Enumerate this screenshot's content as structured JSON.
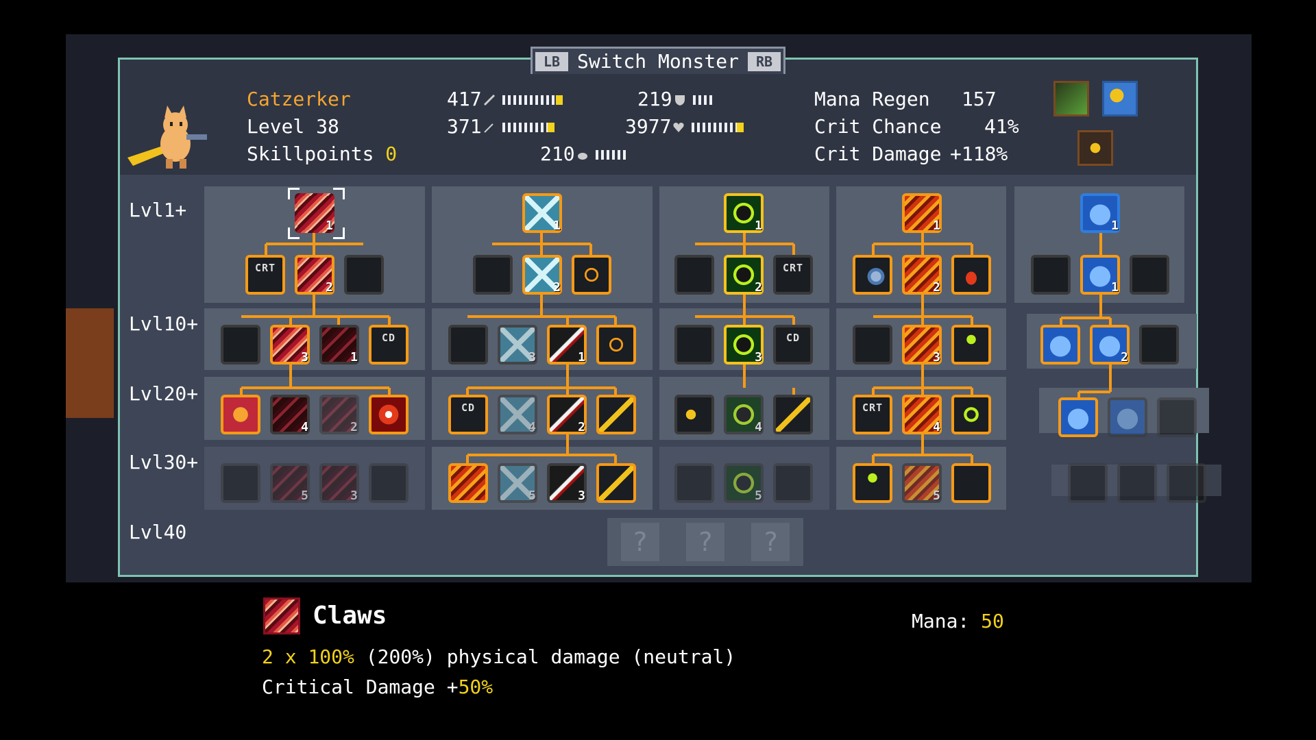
{
  "header": {
    "switch_label": "Switch Monster",
    "lb": "LB",
    "rb": "RB"
  },
  "monster": {
    "name": "Catzerker",
    "level_label": "Level 38",
    "skillpoints_label": "Skillpoints",
    "skillpoints_value": "0"
  },
  "stats": {
    "attack": "417",
    "magic": "371",
    "defense": "219",
    "health": "3977",
    "mana": "210",
    "mana_regen_label": "Mana Regen",
    "mana_regen_value": "157",
    "crit_chance_label": "Crit Chance",
    "crit_chance_value": "41%",
    "crit_damage_label": "Crit Damage",
    "crit_damage_value": "+118%"
  },
  "rows": {
    "lvl1": "Lvl1+",
    "lvl10": "Lvl10+",
    "lvl20": "Lvl20+",
    "lvl30": "Lvl30+",
    "lvl40": "Lvl40"
  },
  "skill_text": {
    "crt": "CRT",
    "cd": "CD",
    "q": "?"
  },
  "ranks": [
    "1",
    "2",
    "3",
    "4",
    "5"
  ],
  "tooltip": {
    "title": "Claws",
    "mana_label": "Mana:",
    "mana_value": "50",
    "line1_a": "2 x ",
    "line1_b": "100%",
    "line1_c": " (200%) physical damage (neutral)",
    "line2_a": "Critical Damage +",
    "line2_b": "50%"
  },
  "colors": {
    "accent_orange": "#f59a16",
    "accent_blue": "#2f7de0",
    "highlight_yellow": "#f2d21c",
    "frame": "#7fc3b3"
  }
}
